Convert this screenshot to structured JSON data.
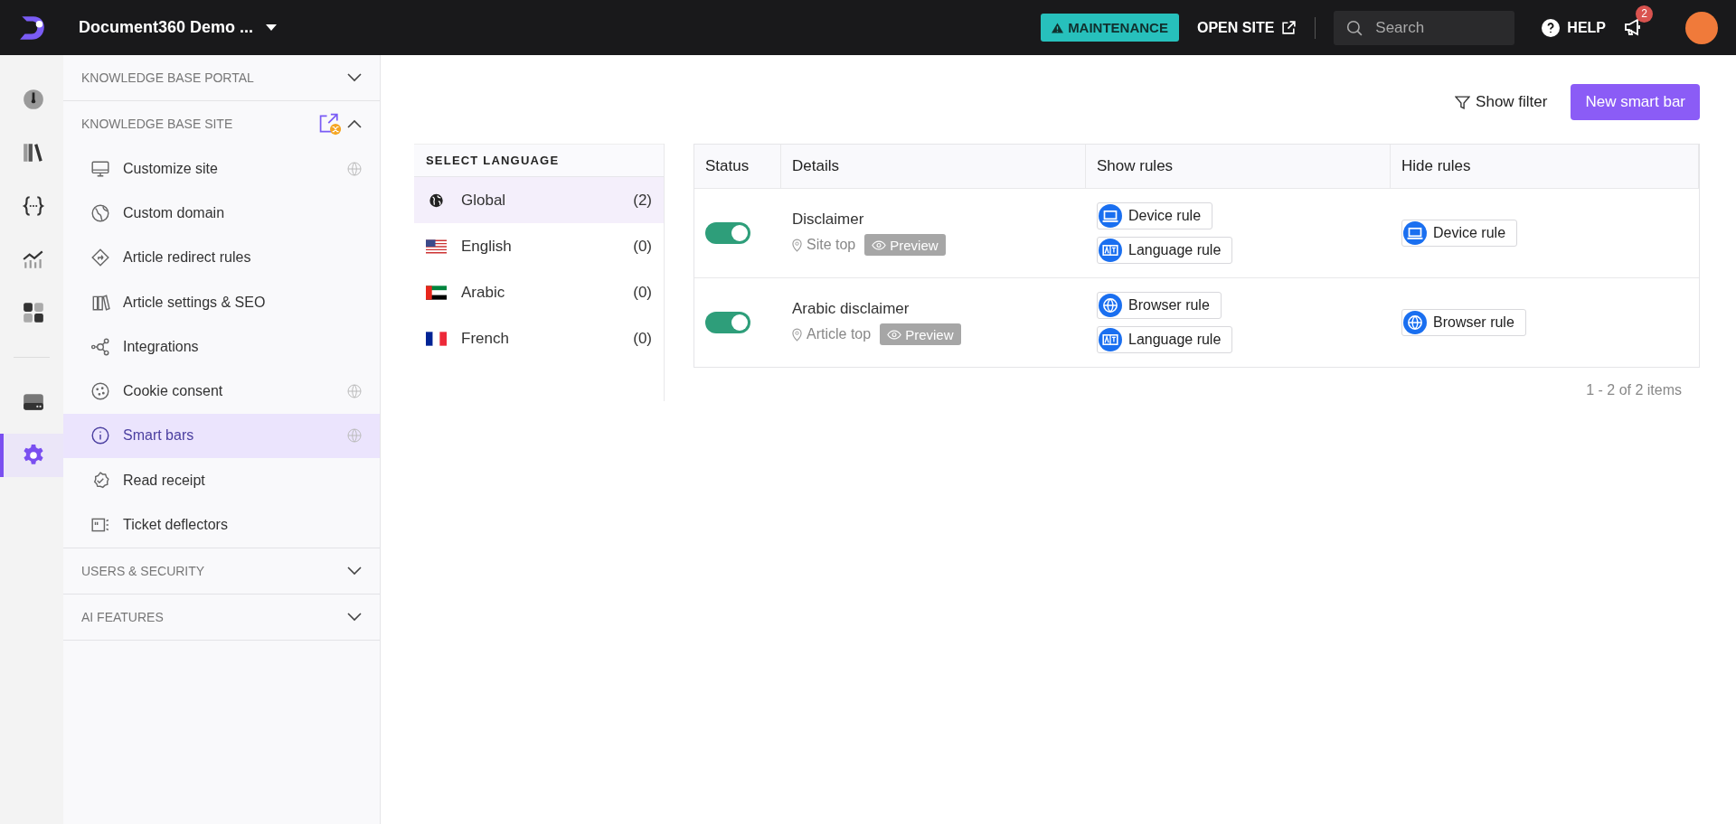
{
  "topbar": {
    "project": "Document360 Demo ...",
    "maintenance": "MAINTENANCE",
    "open_site": "OPEN SITE",
    "search": {
      "placeholder": "Search"
    },
    "help": "HELP",
    "notifications": "2"
  },
  "rail": [
    {
      "kind": "dashboard",
      "selected": false
    },
    {
      "kind": "library",
      "selected": false
    },
    {
      "kind": "api",
      "selected": false
    },
    {
      "kind": "analytics",
      "selected": false
    },
    {
      "kind": "apps",
      "selected": false
    },
    {
      "kind": "drive",
      "selected": false
    },
    {
      "kind": "settings",
      "selected": true
    }
  ],
  "sidebar": [
    {
      "title": "KNOWLEDGE BASE PORTAL",
      "expanded": false
    },
    {
      "title": "KNOWLEDGE BASE SITE",
      "expanded": true,
      "items": [
        {
          "kind": "monitor",
          "label": "Customize site",
          "globe": true,
          "selected": false
        },
        {
          "kind": "domain",
          "label": "Custom domain",
          "globe": false,
          "selected": false
        },
        {
          "kind": "redirect",
          "label": "Article redirect rules",
          "globe": false,
          "selected": false
        },
        {
          "kind": "seo",
          "label": "Article settings & SEO",
          "globe": false,
          "selected": false
        },
        {
          "kind": "integrations",
          "label": "Integrations",
          "globe": false,
          "selected": false
        },
        {
          "kind": "cookie",
          "label": "Cookie consent",
          "globe": true,
          "selected": false
        },
        {
          "kind": "info",
          "label": "Smart bars",
          "globe": true,
          "selected": true
        },
        {
          "kind": "receipt",
          "label": "Read receipt",
          "globe": false,
          "selected": false
        },
        {
          "kind": "ticket",
          "label": "Ticket deflectors",
          "globe": false,
          "selected": false
        }
      ]
    },
    {
      "title": "USERS & SECURITY",
      "expanded": false
    },
    {
      "title": "AI FEATURES",
      "expanded": false
    }
  ],
  "toolbar": {
    "show_filter": "Show filter",
    "new_button": "New smart bar"
  },
  "languages": {
    "title": "SELECT LANGUAGE",
    "items": [
      {
        "kind": "global",
        "label": "Global",
        "count": "(2)",
        "selected": true
      },
      {
        "kind": "us",
        "label": "English",
        "count": "(0)",
        "selected": false
      },
      {
        "kind": "ae",
        "label": "Arabic",
        "count": "(0)",
        "selected": false
      },
      {
        "kind": "fr",
        "label": "French",
        "count": "(0)",
        "selected": false
      }
    ]
  },
  "table": {
    "columns": [
      "Status",
      "Details",
      "Show rules",
      "Hide rules"
    ],
    "rows": [
      {
        "on": true,
        "name": "Disclaimer",
        "position": "Site top",
        "preview": "Preview",
        "show_rules": [
          {
            "kind": "device",
            "label": "Device rule"
          },
          {
            "kind": "language",
            "label": "Language rule"
          }
        ],
        "hide_rules": [
          {
            "kind": "device",
            "label": "Device rule"
          }
        ]
      },
      {
        "on": true,
        "name": "Arabic disclaimer",
        "position": "Article top",
        "preview": "Preview",
        "show_rules": [
          {
            "kind": "browser",
            "label": "Browser rule"
          },
          {
            "kind": "language",
            "label": "Language rule"
          }
        ],
        "hide_rules": [
          {
            "kind": "browser",
            "label": "Browser rule"
          }
        ]
      }
    ]
  },
  "pagination": "1 - 2 of 2 items"
}
